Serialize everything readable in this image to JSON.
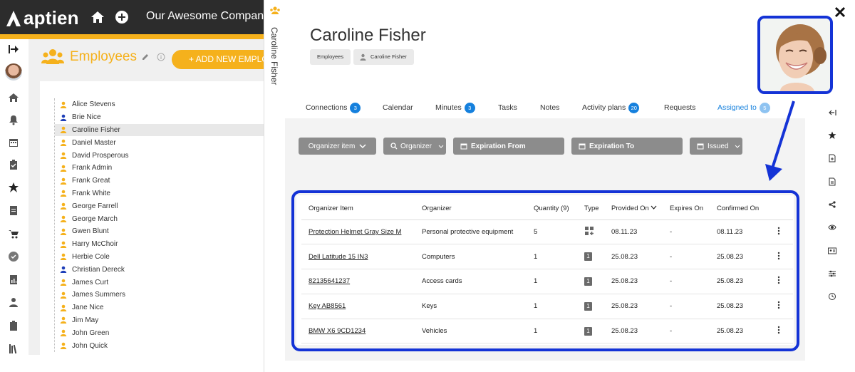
{
  "topbar": {
    "logo_text": "aptien",
    "company": "Our Awesome Company"
  },
  "employees": {
    "title": "Employees",
    "add_label": "+ ADD NEW EMPLOYEE",
    "items": [
      {
        "name": "Alice Stevens",
        "color": "#f5b11c"
      },
      {
        "name": "Brie Nice",
        "color": "#1f3fb8"
      },
      {
        "name": "Caroline Fisher",
        "color": "#f5b11c"
      },
      {
        "name": "Daniel Master",
        "color": "#f5b11c"
      },
      {
        "name": "David Prosperous",
        "color": "#f5b11c"
      },
      {
        "name": "Frank Admin",
        "color": "#f5b11c"
      },
      {
        "name": "Frank Great",
        "color": "#f5b11c"
      },
      {
        "name": "Frank White",
        "color": "#f5b11c"
      },
      {
        "name": "George Farrell",
        "color": "#f5b11c"
      },
      {
        "name": "George March",
        "color": "#f5b11c"
      },
      {
        "name": "Gwen Blunt",
        "color": "#f5b11c"
      },
      {
        "name": "Harry McChoir",
        "color": "#f5b11c"
      },
      {
        "name": "Herbie Cole",
        "color": "#f5b11c"
      },
      {
        "name": "Christian Dereck",
        "color": "#1f3fb8"
      },
      {
        "name": "James Curt",
        "color": "#f5b11c"
      },
      {
        "name": "James Summers",
        "color": "#f5b11c"
      },
      {
        "name": "Jane Nice",
        "color": "#f5b11c"
      },
      {
        "name": "Jim May",
        "color": "#f5b11c"
      },
      {
        "name": "John Green",
        "color": "#f5b11c"
      },
      {
        "name": "John Quick",
        "color": "#f5b11c"
      }
    ],
    "selected_index": 2
  },
  "panel": {
    "side_title": "Caroline Fisher",
    "title": "Caroline Fisher",
    "breadcrumbs": [
      "Employees",
      "Caroline Fisher"
    ],
    "tabs": [
      {
        "label": "Connections",
        "badge": "3"
      },
      {
        "label": "Calendar",
        "badge": ""
      },
      {
        "label": "Minutes",
        "badge": "3"
      },
      {
        "label": "Tasks",
        "badge": ""
      },
      {
        "label": "Notes",
        "badge": ""
      },
      {
        "label": "Activity plans",
        "badge": "20"
      },
      {
        "label": "Requests",
        "badge": ""
      },
      {
        "label": "Assigned to",
        "badge": "5"
      }
    ],
    "active_tab": 7,
    "filters": [
      "Organizer item",
      "Organizer",
      "Expiration From",
      "Expiration To",
      "Issued"
    ],
    "table": {
      "headers": [
        "Organizer Item",
        "Organizer",
        "Quantity (9)",
        "Type",
        "Provided On",
        "Expires On",
        "Confirmed On"
      ],
      "rows": [
        {
          "item": "Protection Helmet Gray Size M",
          "organizer": "Personal protective equipment",
          "quantity": "5",
          "type": "multi",
          "provided": "08.11.23",
          "expires": "-",
          "confirmed": "08.11.23"
        },
        {
          "item": "Dell Latitude 15 IN3",
          "organizer": "Computers",
          "quantity": "1",
          "type": "1",
          "provided": "25.08.23",
          "expires": "-",
          "confirmed": "25.08.23"
        },
        {
          "item": "82135641237",
          "organizer": "Access cards",
          "quantity": "1",
          "type": "1",
          "provided": "25.08.23",
          "expires": "-",
          "confirmed": "25.08.23"
        },
        {
          "item": "Key AB8561",
          "organizer": "Keys",
          "quantity": "1",
          "type": "1",
          "provided": "25.08.23",
          "expires": "-",
          "confirmed": "25.08.23"
        },
        {
          "item": "BMW X6 9CD1234",
          "organizer": "Vehicles",
          "quantity": "1",
          "type": "1",
          "provided": "25.08.23",
          "expires": "-",
          "confirmed": "25.08.23"
        }
      ]
    }
  },
  "colors": {
    "accent": "#f5b11c",
    "topbar": "#2c2c2c",
    "link_blue": "#1580dd",
    "highlight": "#1433d6",
    "filter_gray": "#8c8c8c"
  },
  "icons": {
    "left_rail": [
      "collapse-arrow-icon",
      "avatar",
      "home-icon",
      "bell-icon",
      "calendar-icon",
      "clipboard-icon",
      "star-icon",
      "document-icon",
      "cart-icon",
      "check-circle-icon",
      "report-icon",
      "person-icon",
      "clipboard-list-icon",
      "library-icon"
    ],
    "right_rail": [
      "collapse-left-icon",
      "star-icon",
      "file-icon",
      "document-icon",
      "share-icon",
      "eye-icon",
      "id-card-icon",
      "settings-sliders-icon",
      "history-icon"
    ]
  }
}
